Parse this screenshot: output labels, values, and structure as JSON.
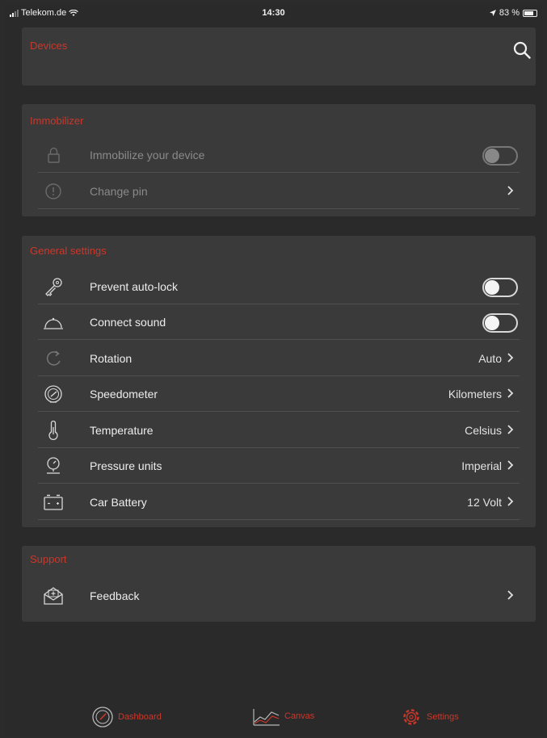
{
  "statusbar": {
    "carrier": "Telekom.de",
    "time": "14:30",
    "battery": "83 %"
  },
  "devices": {
    "title": "Devices"
  },
  "immobilizer": {
    "title": "Immobilizer",
    "items": [
      {
        "label": "Immobilize your device",
        "icon": "lock-icon"
      },
      {
        "label": "Change pin",
        "icon": "pin-icon"
      }
    ]
  },
  "general": {
    "title": "General settings",
    "items": [
      {
        "label": "Prevent auto-lock",
        "icon": "key-icon",
        "toggle": false
      },
      {
        "label": "Connect sound",
        "icon": "bell-icon",
        "toggle": false
      },
      {
        "label": "Rotation",
        "icon": "rotation-icon",
        "value": "Auto"
      },
      {
        "label": "Speedometer",
        "icon": "speedometer-icon",
        "value": "Kilometers"
      },
      {
        "label": "Temperature",
        "icon": "thermometer-icon",
        "value": "Celsius"
      },
      {
        "label": "Pressure units",
        "icon": "pressure-icon",
        "value": "Imperial"
      },
      {
        "label": "Car Battery",
        "icon": "battery-icon",
        "value": "12 Volt"
      }
    ]
  },
  "support": {
    "title": "Support",
    "items": [
      {
        "label": "Feedback",
        "icon": "feedback-icon"
      }
    ]
  },
  "tabbar": {
    "items": [
      {
        "label": "Dashboard",
        "icon": "dashboard-icon"
      },
      {
        "label": "Canvas",
        "icon": "chart-icon"
      },
      {
        "label": "Settings",
        "icon": "settings-gear-icon"
      }
    ]
  },
  "colors": {
    "accent": "#c9382b",
    "background": "#2a2a2a",
    "card": "#3a3a3a"
  }
}
